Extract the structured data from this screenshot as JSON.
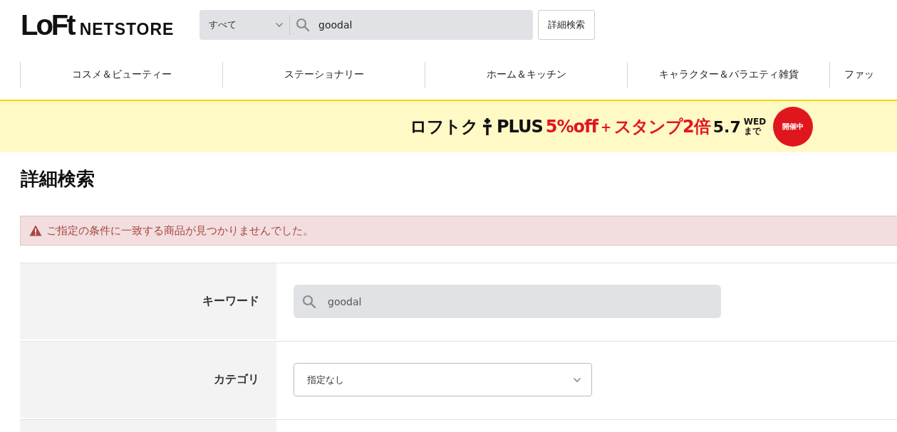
{
  "header": {
    "logo_main": "LoFt",
    "logo_sub": "NETSTORE",
    "search": {
      "scope": "すべて",
      "value": "goodal"
    },
    "advanced_button": "詳細検索"
  },
  "nav": [
    {
      "label": "コスメ＆ビューティー"
    },
    {
      "label": "ステーショナリー"
    },
    {
      "label": "ホーム＆キッチン"
    },
    {
      "label": "キャラクター＆バラエティ雑貨"
    },
    {
      "label": "ファッ"
    }
  ],
  "banner": {
    "brand": "ロフトク",
    "brand_suffix": "PLUS",
    "offer": "5%off",
    "plus": "+",
    "stamp": "スタンプ2倍",
    "date": "5.7",
    "weekday": "WED",
    "until": "まで",
    "badge": "開催中"
  },
  "page_title": "詳細検索",
  "alert": "ご指定の条件に一致する商品が見つかりませんでした。",
  "form": [
    {
      "kind": "search",
      "label": "キーワード",
      "value": "goodal"
    },
    {
      "kind": "select",
      "label": "カテゴリ",
      "value": "指定なし"
    },
    {
      "kind": "empty"
    }
  ]
}
